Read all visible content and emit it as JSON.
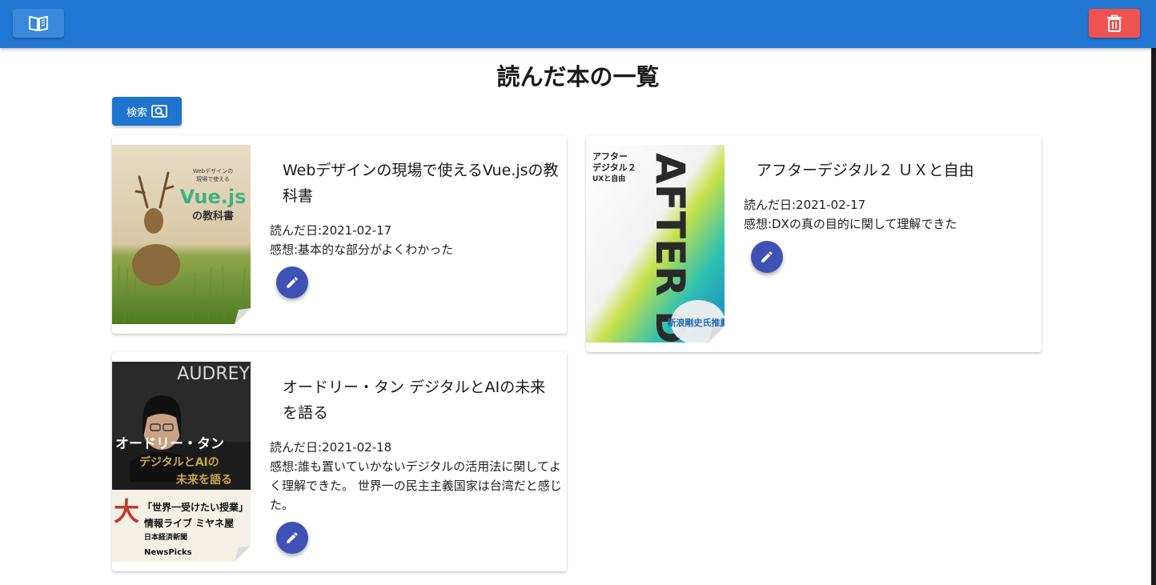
{
  "header": {
    "book_icon": "book-open-icon",
    "trash_icon": "trash-icon",
    "colors": {
      "appbar": "#2176d2",
      "delete": "#ef5350",
      "fab": "#3f51b5"
    }
  },
  "main": {
    "title": "読んだ本の一覧",
    "search_label": "検索",
    "search_icon": "search-icon"
  },
  "books": [
    {
      "title": "Webデザインの現場で使えるVue.jsの教科書",
      "date": "読んだ日:2021-02-17",
      "impression": "感想:基本的な部分がよくわかった",
      "cover": {
        "line1": "Webデザインの",
        "line2": "現場で使える",
        "big": "Vue.js",
        "sub": "の教科書"
      }
    },
    {
      "title": "アフターデジタル２ ＵＸと自由",
      "date": "読んだ日:2021-02-17",
      "impression": "感想:DXの真の目的に関して理解できた",
      "cover": {
        "jp1": "アフター",
        "jp2": "デジタル２",
        "jp3": "UXと自由",
        "vertical": "AFTER DIGITAL",
        "badge": "新浪剛史氏推薦"
      }
    },
    {
      "title": "オードリー・タン デジタルとAIの未来を語る",
      "date": "読んだ日:2021-02-18",
      "impression": "感想:誰も置いていかないデジタルの活用法に関してよく理解できた。 世界一の民主主義国家は台湾だと感じた。",
      "cover": {
        "en": "AUDREY",
        "name": "オードリー・タン",
        "sub1": "デジタルとAIの",
        "sub2": "未来を語る",
        "band1": "「世界一受けたい授業」",
        "band2": "情報ライブ ミヤネ屋",
        "band3": "日本経済新聞",
        "band4": "NewsPicks"
      }
    }
  ]
}
